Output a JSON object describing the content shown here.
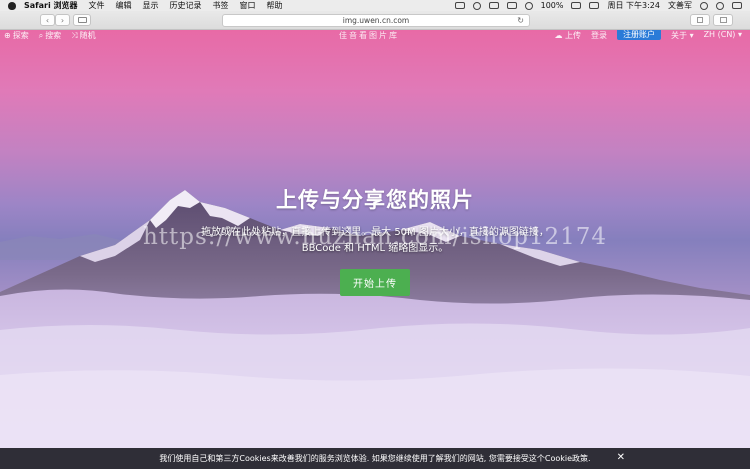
{
  "menubar": {
    "app": "Safari 浏览器",
    "items": [
      "文件",
      "编辑",
      "显示",
      "历史记录",
      "书签",
      "窗口",
      "帮助"
    ],
    "battery": "100%",
    "clock": "周日 下午3:24",
    "user": "文善军"
  },
  "browser": {
    "url": "img.uwen.cn.com",
    "back": "‹",
    "forward": "›"
  },
  "nav": {
    "explore": "探索",
    "search": "搜索",
    "random": "随机",
    "logo": "佳音看图片库",
    "upload": "上传",
    "login": "登录",
    "signup": "注册账户",
    "about": "关于",
    "language": "ZH (CN)"
  },
  "hero": {
    "title": "上传与分享您的照片",
    "subtitle_line1": "拖放或在此处粘贴，直接上传到这里。最大 50M 图片大小，直接的源图链接，",
    "subtitle_line2": "BBCode 和 HTML 缩略图显示。",
    "watermark": "https://www.huzhan.com/ishop12174",
    "button": "开始上传"
  },
  "cookie": {
    "text": "我们使用自己和第三方Cookies来改善我们的服务浏览体验. 如果您继续使用了解我们的网站, 您需要接受这个Cookie政策.",
    "close": "✕"
  },
  "colors": {
    "signup_blue": "#2a7bd8",
    "start_green": "#4caf50"
  }
}
